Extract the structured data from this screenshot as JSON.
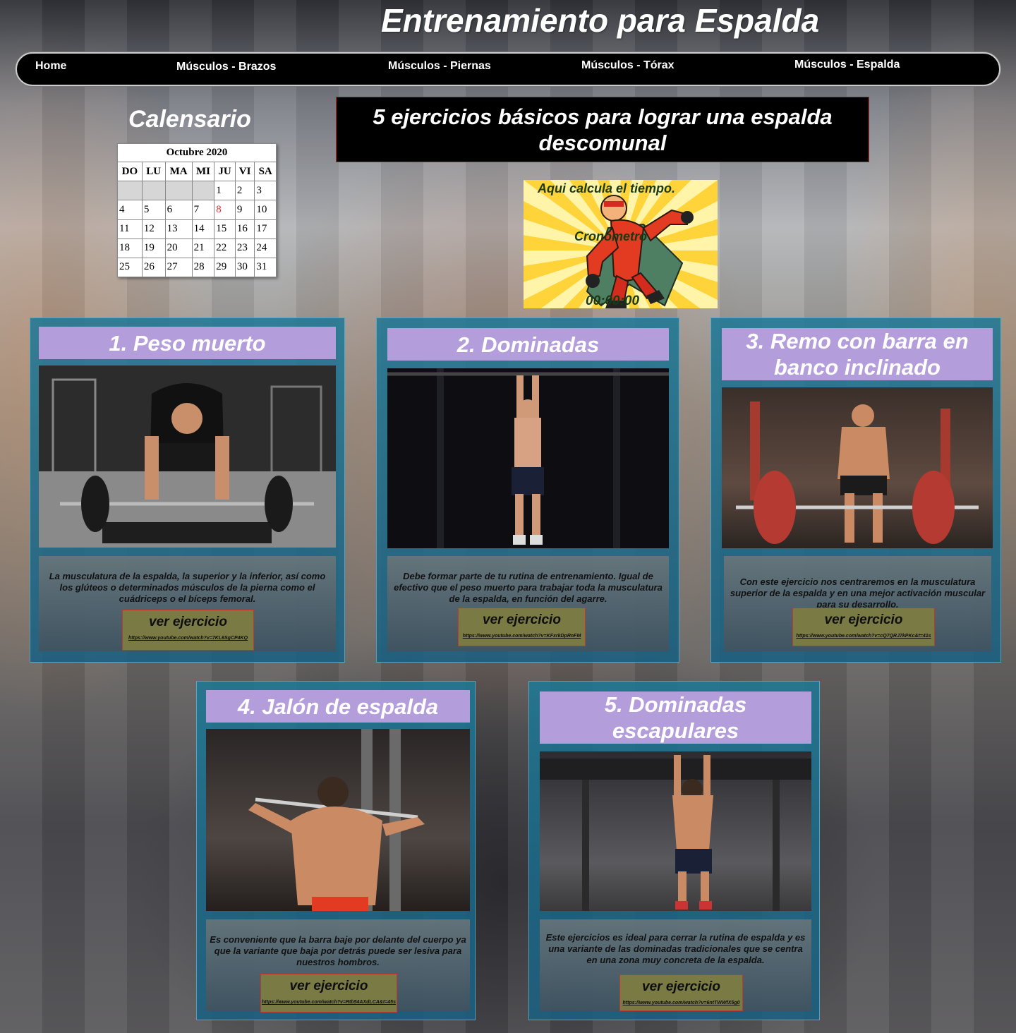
{
  "header": {
    "title": "Entrenamiento para Espalda"
  },
  "nav": {
    "items": [
      {
        "label": "Home"
      },
      {
        "label": "Músculos - Brazos"
      },
      {
        "label": "Músculos - Piernas"
      },
      {
        "label": "Músculos - Tórax"
      },
      {
        "label": "Músculos - Espalda"
      }
    ]
  },
  "calendar": {
    "heading": "Calensario",
    "caption": "Octubre 2020",
    "weekdays": [
      "DO",
      "LU",
      "MA",
      "MI",
      "JU",
      "VI",
      "SA"
    ],
    "days": [
      [
        "",
        "",
        "",
        "",
        "1",
        "2",
        "3"
      ],
      [
        "4",
        "5",
        "6",
        "7",
        "8",
        "9",
        "10"
      ],
      [
        "11",
        "12",
        "13",
        "14",
        "15",
        "16",
        "17"
      ],
      [
        "18",
        "19",
        "20",
        "21",
        "22",
        "23",
        "24"
      ],
      [
        "25",
        "26",
        "27",
        "28",
        "29",
        "30",
        "31"
      ]
    ],
    "today": "8",
    "today_color": "#e03030"
  },
  "main": {
    "headline": "5 ejercicios básicos para lograr una espalda descomunal"
  },
  "timer": {
    "prompt": "Aqui calcula el tiempo.",
    "label": "Cronómetro",
    "value": "00:00:00"
  },
  "exercises": [
    {
      "title": "1. Peso muerto",
      "description": "La musculatura de la espalda, la superior y la inferior, así como los glúteos o determinados músculos de la pierna como el cuádriceps o el bíceps femoral.",
      "button_label": "ver ejercicio",
      "link": "https://www.youtube.com/watch?v=7KL6SgCP4KQ"
    },
    {
      "title": "2. Dominadas",
      "description": "Debe formar parte de tu rutina de entrenamiento. Igual de efectivo que el peso muerto para trabajar toda la musculatura de la espalda, en función del agarre.",
      "button_label": "ver ejercicio",
      "link": "https://www.youtube.com/watch?v=KFxrkDpRnFM"
    },
    {
      "title": "3. Remo con barra en banco inclinado",
      "description": "Con este ejercicio nos centraremos en la musculatura superior de la espalda y en una mejor activación muscular para su desarrollo.",
      "button_label": "ver ejercicio",
      "link": "https://www.youtube.com/watch?v=cQ7QRJ7kPKc&t=41s"
    },
    {
      "title": "4. Jalón de espalda",
      "description": "Es conveniente que la barra baje por delante del cuerpo ya que la variante que baja por detrás puede ser lesiva para nuestros hombros.",
      "button_label": "ver ejercicio",
      "link": "https://www.youtube.com/watch?v=Rtb54AXdLCA&t=45s"
    },
    {
      "title": "5. Dominadas escapulares",
      "description": "Este ejercicios es ideal para cerrar la rutina de espalda y es una variante de las dominadas tradicionales que se centra en una zona muy concreta de la espalda.",
      "button_label": "ver ejercicio",
      "link": "https://www.youtube.com/watch?v=6ntTWWfX5g0"
    }
  ],
  "colors": {
    "title_bar": "#b39ddb",
    "card_bg": "#1c7896",
    "button_bg": "#7a7a44",
    "button_border": "#c0392b",
    "timer_yellow": "#ffd43b"
  }
}
